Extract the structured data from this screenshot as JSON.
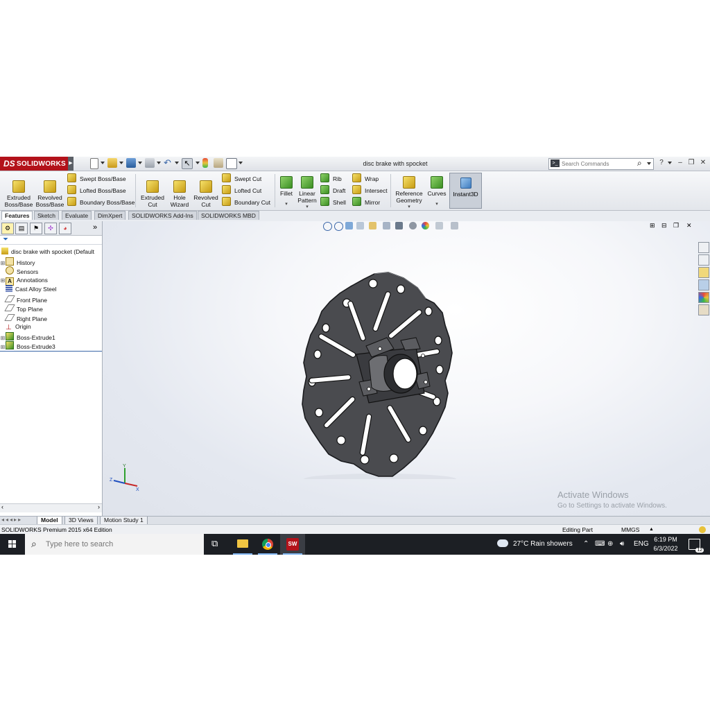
{
  "app": {
    "brand": "SOLIDWORKS",
    "brand_prefix": "DS",
    "document_title": "disc brake with spocket",
    "search_placeholder": "Search Commands"
  },
  "command_manager": {
    "big_buttons": [
      {
        "label": "Extruded\nBoss/Base",
        "name": "extruded-boss-base-button"
      },
      {
        "label": "Revolved\nBoss/Base",
        "name": "revolved-boss-base-button"
      }
    ],
    "boss_small": [
      "Swept Boss/Base",
      "Lofted Boss/Base",
      "Boundary Boss/Base"
    ],
    "cut_big": [
      "Extruded\nCut",
      "Hole\nWizard",
      "Revolved\nCut"
    ],
    "cut_small": [
      "Swept Cut",
      "Lofted Cut",
      "Boundary Cut"
    ],
    "fillet": "Fillet",
    "linear_pattern": "Linear\nPattern",
    "features_small_1": [
      "Rib",
      "Draft",
      "Shell"
    ],
    "features_small_2": [
      "Wrap",
      "Intersect",
      "Mirror"
    ],
    "reference_geometry": "Reference\nGeometry",
    "curves": "Curves",
    "instant3d": "Instant3D"
  },
  "tabs": [
    "Features",
    "Sketch",
    "Evaluate",
    "DimXpert",
    "SOLIDWORKS Add-Ins",
    "SOLIDWORKS MBD"
  ],
  "tree": {
    "root": "disc brake with spocket  (Default",
    "items": [
      {
        "label": "History",
        "expandable": true
      },
      {
        "label": "Sensors",
        "expandable": false
      },
      {
        "label": "Annotations",
        "expandable": true
      },
      {
        "label": "Cast Alloy Steel",
        "expandable": false
      },
      {
        "label": "Front Plane",
        "expandable": false
      },
      {
        "label": "Top Plane",
        "expandable": false
      },
      {
        "label": "Right Plane",
        "expandable": false
      },
      {
        "label": "Origin",
        "expandable": false
      },
      {
        "label": "Boss-Extrude1",
        "expandable": true
      },
      {
        "label": "Boss-Extrude3",
        "expandable": true
      }
    ]
  },
  "bottom_tabs": [
    "Model",
    "3D Views",
    "Motion Study 1"
  ],
  "status": {
    "edition": "SOLIDWORKS Premium 2015 x64 Edition",
    "mode": "Editing Part",
    "units": "MMGS"
  },
  "watermark": {
    "line1": "Activate Windows",
    "line2": "Go to Settings to activate Windows."
  },
  "taskbar": {
    "search_placeholder": "Type here to search",
    "weather": "27°C  Rain showers",
    "language": "ENG",
    "time": "6:19 PM",
    "date": "6/3/2022",
    "notifications": "12"
  },
  "colors": {
    "brand_red": "#b3121a",
    "part_gray": "#4a4b4f",
    "taskbar": "#1c1f24"
  }
}
